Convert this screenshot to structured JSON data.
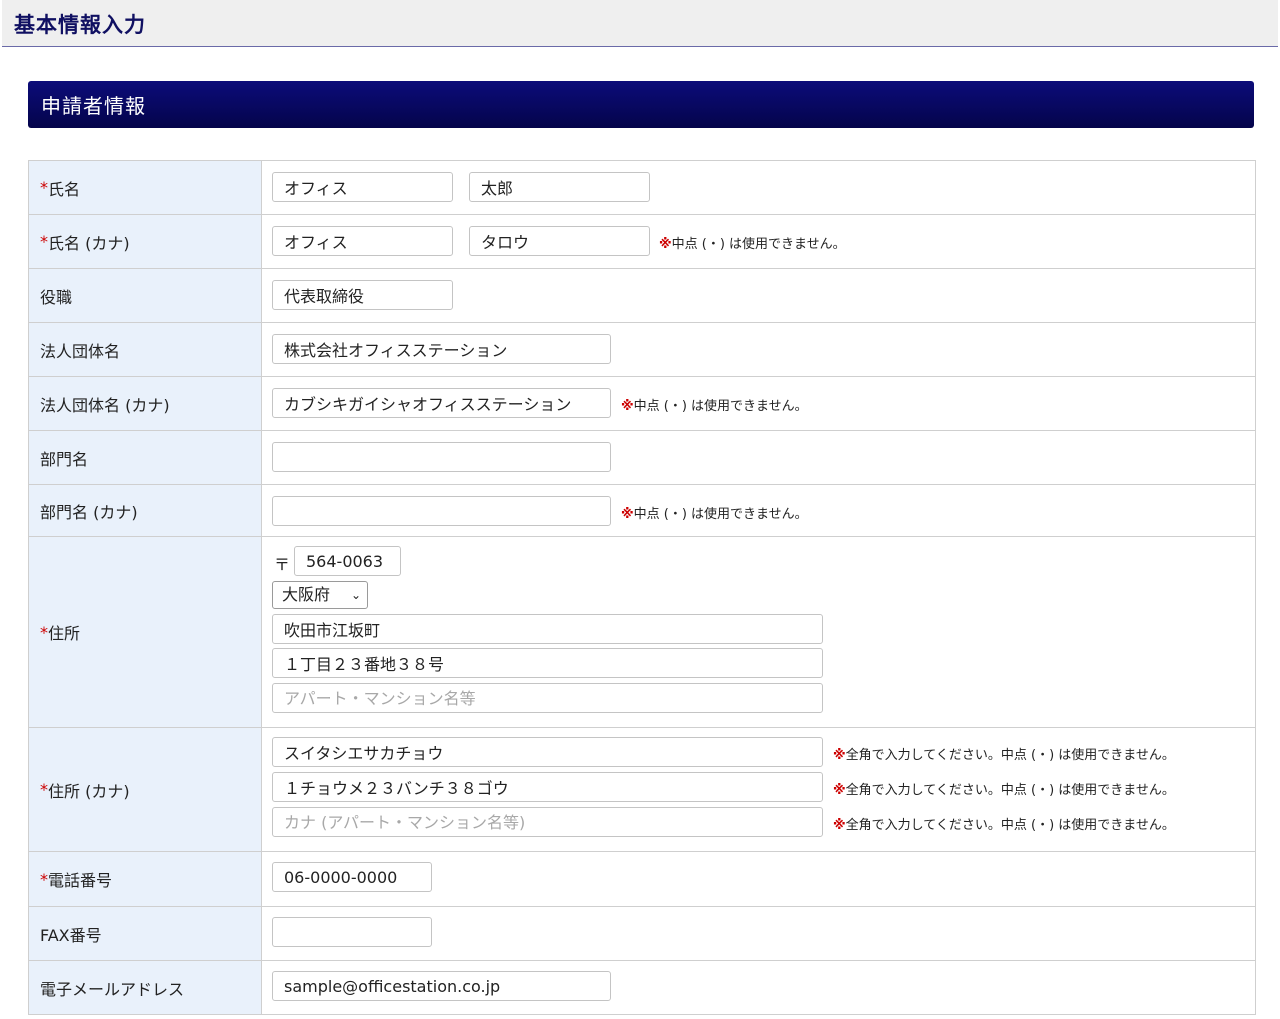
{
  "header": {
    "title": "基本情報入力"
  },
  "section": {
    "title": "申請者情報"
  },
  "required_mark": "*",
  "note_mark": "※",
  "colors": {
    "header_bg": "#efefef",
    "section_bg": "#04044a",
    "label_bg": "#e9f1fb",
    "required": "#cc0000"
  },
  "fields": {
    "name": {
      "label": "氏名",
      "last": "オフィス",
      "first": "太郎"
    },
    "name_kana": {
      "label": "氏名 (カナ)",
      "last": "オフィス",
      "first": "タロウ",
      "note": "中点 (・) は使用できません。"
    },
    "position": {
      "label": "役職",
      "value": "代表取締役"
    },
    "corp": {
      "label": "法人団体名",
      "value": "株式会社オフィスステーション"
    },
    "corp_kana": {
      "label": "法人団体名 (カナ)",
      "value": "カブシキガイシャオフィスステーション",
      "note": "中点 (・) は使用できません。"
    },
    "dept": {
      "label": "部門名",
      "value": ""
    },
    "dept_kana": {
      "label": "部門名 (カナ)",
      "value": "",
      "note": "中点 (・) は使用できません。"
    },
    "address": {
      "label": "住所",
      "zip_symbol": "〒",
      "zip": "564-0063",
      "prefecture": "大阪府",
      "city": "吹田市江坂町",
      "street": "１丁目２３番地３８号",
      "building": "",
      "building_placeholder": "アパート・マンション名等"
    },
    "address_kana": {
      "label": "住所 (カナ)",
      "city": "スイタシエサカチョウ",
      "street": "１チョウメ２３バンチ３８ゴウ",
      "building": "",
      "building_placeholder": "カナ (アパート・マンション名等)",
      "note": "全角で入力してください。中点 (・) は使用できません。"
    },
    "phone": {
      "label": "電話番号",
      "value": "06-0000-0000"
    },
    "fax": {
      "label": "FAX番号",
      "value": ""
    },
    "email": {
      "label": "電子メールアドレス",
      "value": "sample@officestation.co.jp"
    }
  }
}
